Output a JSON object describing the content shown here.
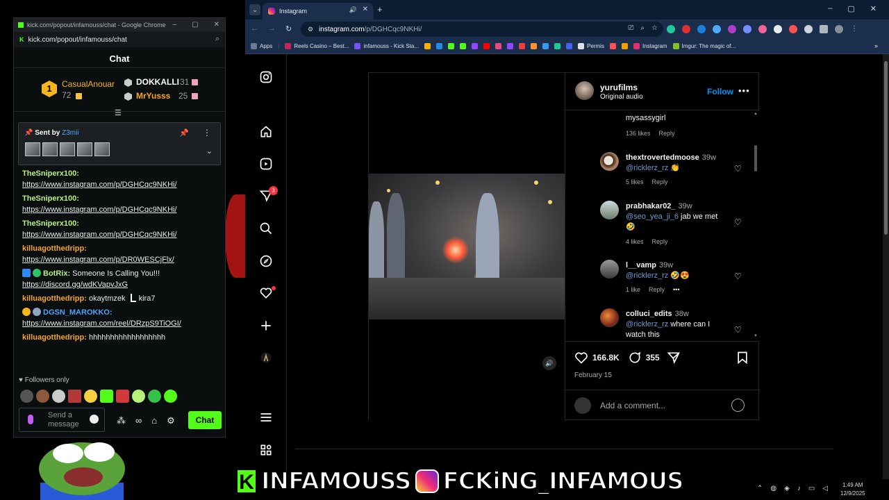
{
  "kick_window": {
    "title": "kick.com/popout/infamouss/chat - Google Chrome",
    "url": "kick.com/popout/infamouss/chat",
    "chat_title": "Chat",
    "leaderboard": [
      {
        "rank": "1",
        "name": "CasualAnouar",
        "count": "72"
      },
      {
        "name": "DOKKALLI",
        "count": "31"
      },
      {
        "name": "MrYusss",
        "count": "25"
      }
    ],
    "pinned": {
      "label_prefix": "Sent by",
      "user": "Z3mii"
    },
    "messages": [
      {
        "user": "TheSniperx100:",
        "link": "https://www.instagram.com/p/DGHCqc9NKHi/"
      },
      {
        "user": "TheSniperx100:",
        "link": "https://www.instagram.com/p/DGHCqc9NKHi/"
      },
      {
        "user": "TheSniperx100:",
        "link": "https://www.instagram.com/p/DGHCqc9NKHi/"
      },
      {
        "user": "killuagotthedripp:",
        "link": "https://www.instagram.com/p/DR0WESCjFlx/"
      },
      {
        "user": "BotRix:",
        "text": " Someone Is Calling You!!!",
        "link": "https://discord.gg/wdKVapvJxG"
      },
      {
        "user": "killuagotthedripp:",
        "text": " okaytmzek",
        "extra": "kira7"
      },
      {
        "user": "DGSN_MAROKKO:",
        "link": "https://www.instagram.com/reel/DRzpS9TiOGI/"
      },
      {
        "user": "killuagotthedripp:",
        "text": " hhhhhhhhhhhhhhhhhh"
      }
    ],
    "followers_only": "Followers only",
    "input_placeholder": "Send a message",
    "send_label": "Chat",
    "colors": {
      "accent": "#53fc18"
    }
  },
  "browser": {
    "tab_title": "Instagram",
    "url_host": "instagram.com",
    "url_path": "/p/DGHCqc9NKHi/",
    "bookmarks": [
      "Apps",
      "Reels Casino – Best...",
      "infamouss - Kick Sta...",
      "Permis",
      "Instagram",
      "Imgur: The magic of..."
    ]
  },
  "instagram": {
    "notif_count": "3",
    "post": {
      "username": "yurufilms",
      "audio": "Original audio",
      "follow_label": "Follow",
      "likes": "166.8K",
      "comments_count": "355",
      "date": "February 15",
      "add_comment_placeholder": "Add a comment..."
    },
    "comments": [
      {
        "name": "",
        "time": "",
        "body": "mysassygirl",
        "likes": "136 likes",
        "reply": "Reply"
      },
      {
        "name": "thextrovertedmoose",
        "time": "39w",
        "mention": "@ricklerz_rz",
        "body": " 👏",
        "likes": "5 likes",
        "reply": "Reply"
      },
      {
        "name": "prabhakar02_",
        "time": "39w",
        "mention": "@seo_yea_ji_6",
        "body": " jab we met 🤣",
        "likes": "4 likes",
        "reply": "Reply"
      },
      {
        "name": "l__vamp",
        "time": "39w",
        "mention": "@ricklerz_rz",
        "body": " 🤣😍",
        "likes": "1 like",
        "reply": "Reply"
      },
      {
        "name": "colluci_edits",
        "time": "38w",
        "mention": "@ricklerz_rz",
        "body": " where can I watch this",
        "likes": "",
        "reply": ""
      }
    ]
  },
  "overlay": {
    "banner_left": "INFAMOUSS",
    "banner_right": "FCKiNG_INFAMOUS"
  },
  "taskbar": {
    "time": "1:49 AM",
    "date": "12/9/2025"
  }
}
